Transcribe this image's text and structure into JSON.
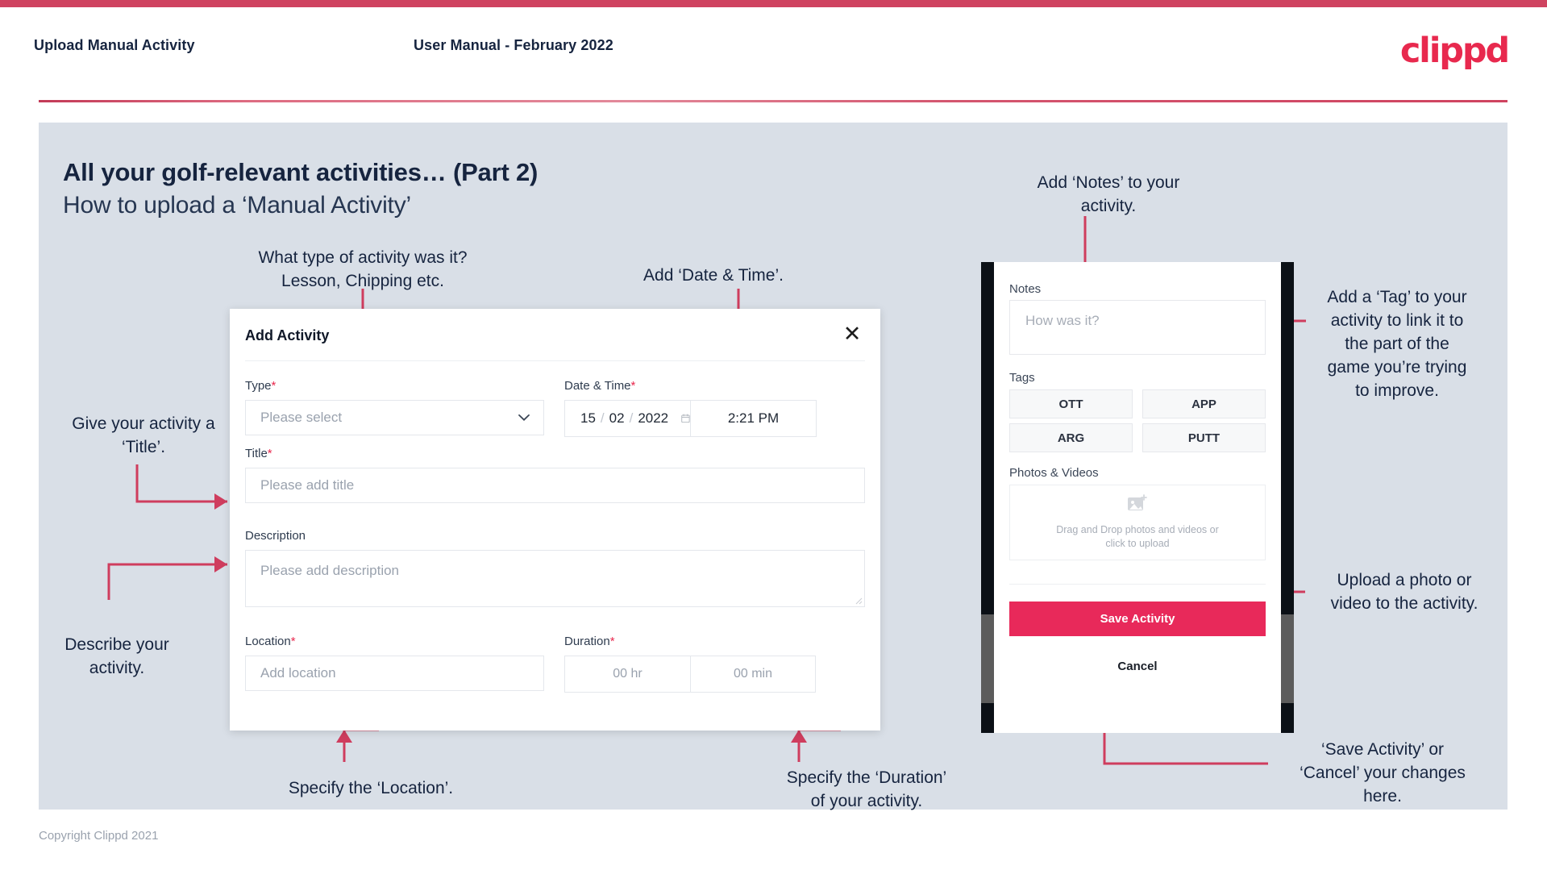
{
  "header": {
    "left_title": "Upload Manual Activity",
    "center_title": "User Manual - February 2022",
    "logo": "clippd"
  },
  "slide": {
    "heading": "All your golf-relevant activities… (Part 2)",
    "subheading": "How to upload a ‘Manual Activity’"
  },
  "annotations": {
    "type": "What type of activity was it?\nLesson, Chipping etc.",
    "datetime": "Add ‘Date & Time’.",
    "title": "Give your activity a\n‘Title’.",
    "description": "Describe your\nactivity.",
    "location": "Specify the ‘Location’.",
    "duration": "Specify the ‘Duration’\nof your activity.",
    "notes": "Add ‘Notes’ to your\nactivity.",
    "tags": "Add a ‘Tag’ to your\nactivity to link it to\nthe part of the\ngame you’re trying\nto improve.",
    "photos": "Upload a photo or\nvideo to the activity.",
    "save": "‘Save Activity’ or\n‘Cancel’ your changes\nhere."
  },
  "dialog": {
    "title": "Add Activity",
    "close_icon": "close-icon",
    "fields": {
      "type": {
        "label": "Type",
        "required": "*",
        "placeholder": "Please select",
        "icon": "chevron-down-icon"
      },
      "datetime": {
        "label": "Date & Time",
        "required": "*",
        "day": "15",
        "month": "02",
        "year": "2022",
        "sep": "/",
        "time": "2:21 PM",
        "icon": "calendar-icon"
      },
      "title": {
        "label": "Title",
        "required": "*",
        "placeholder": "Please add title"
      },
      "description": {
        "label": "Description",
        "required": "",
        "placeholder": "Please add description"
      },
      "location": {
        "label": "Location",
        "required": "*",
        "placeholder": "Add location"
      },
      "duration": {
        "label": "Duration",
        "required": "*",
        "hours": "00 hr",
        "minutes": "00 min"
      }
    }
  },
  "phone": {
    "notes": {
      "label": "Notes",
      "placeholder": "How was it?"
    },
    "tags": {
      "label": "Tags",
      "options": [
        "OTT",
        "APP",
        "ARG",
        "PUTT"
      ]
    },
    "photos": {
      "label": "Photos & Videos",
      "icon": "image-add-icon",
      "line1": "Drag and Drop photos and videos or",
      "line2": "click to upload"
    },
    "save_label": "Save Activity",
    "cancel_label": "Cancel"
  },
  "footer": {
    "copyright": "Copyright Clippd 2021"
  },
  "colors": {
    "brand_pink": "#e8294e",
    "save_pink": "#e8295a",
    "annotation_line": "#cf3d5e",
    "slide_bg": "#d9dfe7",
    "text_dark": "#16243f"
  }
}
